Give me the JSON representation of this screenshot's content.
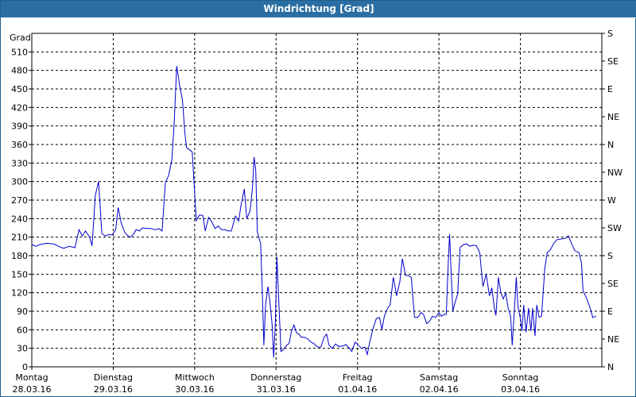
{
  "window": {
    "title": "Windrichtung [Grad]"
  },
  "chart_data": {
    "type": "line",
    "title": "Windrichtung [Grad]",
    "ylabel": "Grad",
    "ylim": [
      0,
      540
    ],
    "yticks": [
      0,
      30,
      60,
      90,
      120,
      150,
      180,
      210,
      240,
      270,
      300,
      330,
      360,
      390,
      420,
      450,
      480,
      510
    ],
    "y2_ticks": [
      {
        "value": 0,
        "label": "N"
      },
      {
        "value": 45,
        "label": "NE"
      },
      {
        "value": 90,
        "label": "E"
      },
      {
        "value": 135,
        "label": "SE"
      },
      {
        "value": 180,
        "label": "S"
      },
      {
        "value": 225,
        "label": "SW"
      },
      {
        "value": 270,
        "label": "W"
      },
      {
        "value": 315,
        "label": "NW"
      },
      {
        "value": 360,
        "label": "N"
      },
      {
        "value": 405,
        "label": "NE"
      },
      {
        "value": 450,
        "label": "E"
      },
      {
        "value": 495,
        "label": "SE"
      },
      {
        "value": 540,
        "label": "S"
      }
    ],
    "xlim": [
      0,
      7
    ],
    "xticks": [
      {
        "day": "Montag",
        "date": "28.03.16"
      },
      {
        "day": "Dienstag",
        "date": "29.03.16"
      },
      {
        "day": "Mittwoch",
        "date": "30.03.16"
      },
      {
        "day": "Donnerstag",
        "date": "31.03.16"
      },
      {
        "day": "Freitag",
        "date": "01.04.16"
      },
      {
        "day": "Samstag",
        "date": "02.04.16"
      },
      {
        "day": "Sonntag",
        "date": "03.04.16"
      }
    ],
    "grid": true,
    "series": [
      {
        "color": "#0000cc",
        "points": [
          [
            0.0,
            198
          ],
          [
            0.05,
            195
          ],
          [
            0.1,
            198
          ],
          [
            0.18,
            200
          ],
          [
            0.27,
            199
          ],
          [
            0.33,
            195
          ],
          [
            0.39,
            192
          ],
          [
            0.46,
            195
          ],
          [
            0.53,
            193
          ],
          [
            0.58,
            222
          ],
          [
            0.62,
            212
          ],
          [
            0.66,
            220
          ],
          [
            0.71,
            210
          ],
          [
            0.74,
            196
          ],
          [
            0.78,
            278
          ],
          [
            0.82,
            300
          ],
          [
            0.86,
            216
          ],
          [
            0.9,
            212
          ],
          [
            0.94,
            214
          ],
          [
            0.99,
            214
          ],
          [
            1.03,
            222
          ],
          [
            1.06,
            258
          ],
          [
            1.1,
            232
          ],
          [
            1.14,
            218
          ],
          [
            1.18,
            212
          ],
          [
            1.21,
            210
          ],
          [
            1.25,
            215
          ],
          [
            1.28,
            222
          ],
          [
            1.32,
            220
          ],
          [
            1.36,
            225
          ],
          [
            1.41,
            224
          ],
          [
            1.46,
            224
          ],
          [
            1.52,
            222
          ],
          [
            1.56,
            224
          ],
          [
            1.6,
            220
          ],
          [
            1.64,
            298
          ],
          [
            1.68,
            310
          ],
          [
            1.72,
            335
          ],
          [
            1.75,
            400
          ],
          [
            1.78,
            487
          ],
          [
            1.82,
            452
          ],
          [
            1.85,
            432
          ],
          [
            1.88,
            378
          ],
          [
            1.9,
            355
          ],
          [
            1.93,
            352
          ],
          [
            1.97,
            348
          ],
          [
            2.02,
            237
          ],
          [
            2.06,
            246
          ],
          [
            2.1,
            245
          ],
          [
            2.13,
            220
          ],
          [
            2.17,
            242
          ],
          [
            2.21,
            235
          ],
          [
            2.25,
            224
          ],
          [
            2.29,
            228
          ],
          [
            2.33,
            222
          ],
          [
            2.37,
            222
          ],
          [
            2.41,
            220
          ],
          [
            2.45,
            220
          ],
          [
            2.5,
            244
          ],
          [
            2.54,
            236
          ],
          [
            2.57,
            262
          ],
          [
            2.61,
            288
          ],
          [
            2.64,
            240
          ],
          [
            2.68,
            252
          ],
          [
            2.71,
            290
          ],
          [
            2.73,
            340
          ],
          [
            2.75,
            318
          ],
          [
            2.77,
            218
          ],
          [
            2.81,
            200
          ],
          [
            2.83,
            125
          ],
          [
            2.85,
            35
          ],
          [
            2.87,
            100
          ],
          [
            2.9,
            130
          ],
          [
            2.92,
            110
          ],
          [
            2.95,
            70
          ],
          [
            2.97,
            15
          ],
          [
            2.99,
            70
          ],
          [
            3.01,
            178
          ],
          [
            3.04,
            85
          ],
          [
            3.06,
            25
          ],
          [
            3.09,
            28
          ],
          [
            3.13,
            35
          ],
          [
            3.16,
            38
          ],
          [
            3.19,
            58
          ],
          [
            3.22,
            68
          ],
          [
            3.25,
            55
          ],
          [
            3.28,
            53
          ],
          [
            3.31,
            48
          ],
          [
            3.35,
            48
          ],
          [
            3.39,
            45
          ],
          [
            3.43,
            40
          ],
          [
            3.47,
            37
          ],
          [
            3.51,
            32
          ],
          [
            3.55,
            32
          ],
          [
            3.59,
            48
          ],
          [
            3.62,
            53
          ],
          [
            3.65,
            35
          ],
          [
            3.69,
            30
          ],
          [
            3.73,
            37
          ],
          [
            3.77,
            33
          ],
          [
            3.82,
            34
          ],
          [
            3.86,
            36
          ],
          [
            3.9,
            30
          ],
          [
            3.93,
            25
          ],
          [
            3.97,
            40
          ],
          [
            4.01,
            35
          ],
          [
            4.05,
            30
          ],
          [
            4.09,
            32
          ],
          [
            4.12,
            20
          ],
          [
            4.15,
            40
          ],
          [
            4.19,
            62
          ],
          [
            4.23,
            78
          ],
          [
            4.27,
            80
          ],
          [
            4.3,
            60
          ],
          [
            4.33,
            82
          ],
          [
            4.37,
            95
          ],
          [
            4.4,
            100
          ],
          [
            4.44,
            145
          ],
          [
            4.48,
            115
          ],
          [
            4.52,
            138
          ],
          [
            4.55,
            175
          ],
          [
            4.59,
            148
          ],
          [
            4.62,
            148
          ],
          [
            4.66,
            145
          ],
          [
            4.7,
            80
          ],
          [
            4.74,
            80
          ],
          [
            4.78,
            88
          ],
          [
            4.81,
            85
          ],
          [
            4.85,
            70
          ],
          [
            4.89,
            75
          ],
          [
            4.92,
            82
          ],
          [
            4.96,
            80
          ],
          [
            5.0,
            88
          ],
          [
            5.03,
            82
          ],
          [
            5.07,
            85
          ],
          [
            5.09,
            85
          ],
          [
            5.11,
            155
          ],
          [
            5.13,
            215
          ],
          [
            5.15,
            152
          ],
          [
            5.17,
            90
          ],
          [
            5.2,
            105
          ],
          [
            5.23,
            118
          ],
          [
            5.26,
            193
          ],
          [
            5.3,
            198
          ],
          [
            5.34,
            199
          ],
          [
            5.38,
            195
          ],
          [
            5.42,
            197
          ],
          [
            5.46,
            196
          ],
          [
            5.5,
            185
          ],
          [
            5.54,
            130
          ],
          [
            5.58,
            150
          ],
          [
            5.62,
            115
          ],
          [
            5.65,
            128
          ],
          [
            5.68,
            95
          ],
          [
            5.7,
            83
          ],
          [
            5.73,
            145
          ],
          [
            5.76,
            120
          ],
          [
            5.79,
            110
          ],
          [
            5.82,
            120
          ],
          [
            5.85,
            95
          ],
          [
            5.88,
            82
          ],
          [
            5.9,
            35
          ],
          [
            5.93,
            100
          ],
          [
            5.95,
            145
          ],
          [
            5.97,
            98
          ],
          [
            6.0,
            78
          ],
          [
            6.02,
            58
          ],
          [
            6.04,
            100
          ],
          [
            6.07,
            56
          ],
          [
            6.1,
            95
          ],
          [
            6.13,
            58
          ],
          [
            6.15,
            95
          ],
          [
            6.18,
            50
          ],
          [
            6.2,
            100
          ],
          [
            6.23,
            80
          ],
          [
            6.26,
            82
          ],
          [
            6.3,
            160
          ],
          [
            6.33,
            185
          ],
          [
            6.37,
            190
          ],
          [
            6.41,
            200
          ],
          [
            6.45,
            206
          ],
          [
            6.5,
            207
          ],
          [
            6.55,
            208
          ],
          [
            6.59,
            212
          ],
          [
            6.63,
            199
          ],
          [
            6.67,
            188
          ],
          [
            6.72,
            185
          ],
          [
            6.75,
            168
          ],
          [
            6.77,
            123
          ],
          [
            6.81,
            112
          ],
          [
            6.85,
            98
          ],
          [
            6.89,
            80
          ],
          [
            6.93,
            82
          ]
        ]
      }
    ]
  }
}
